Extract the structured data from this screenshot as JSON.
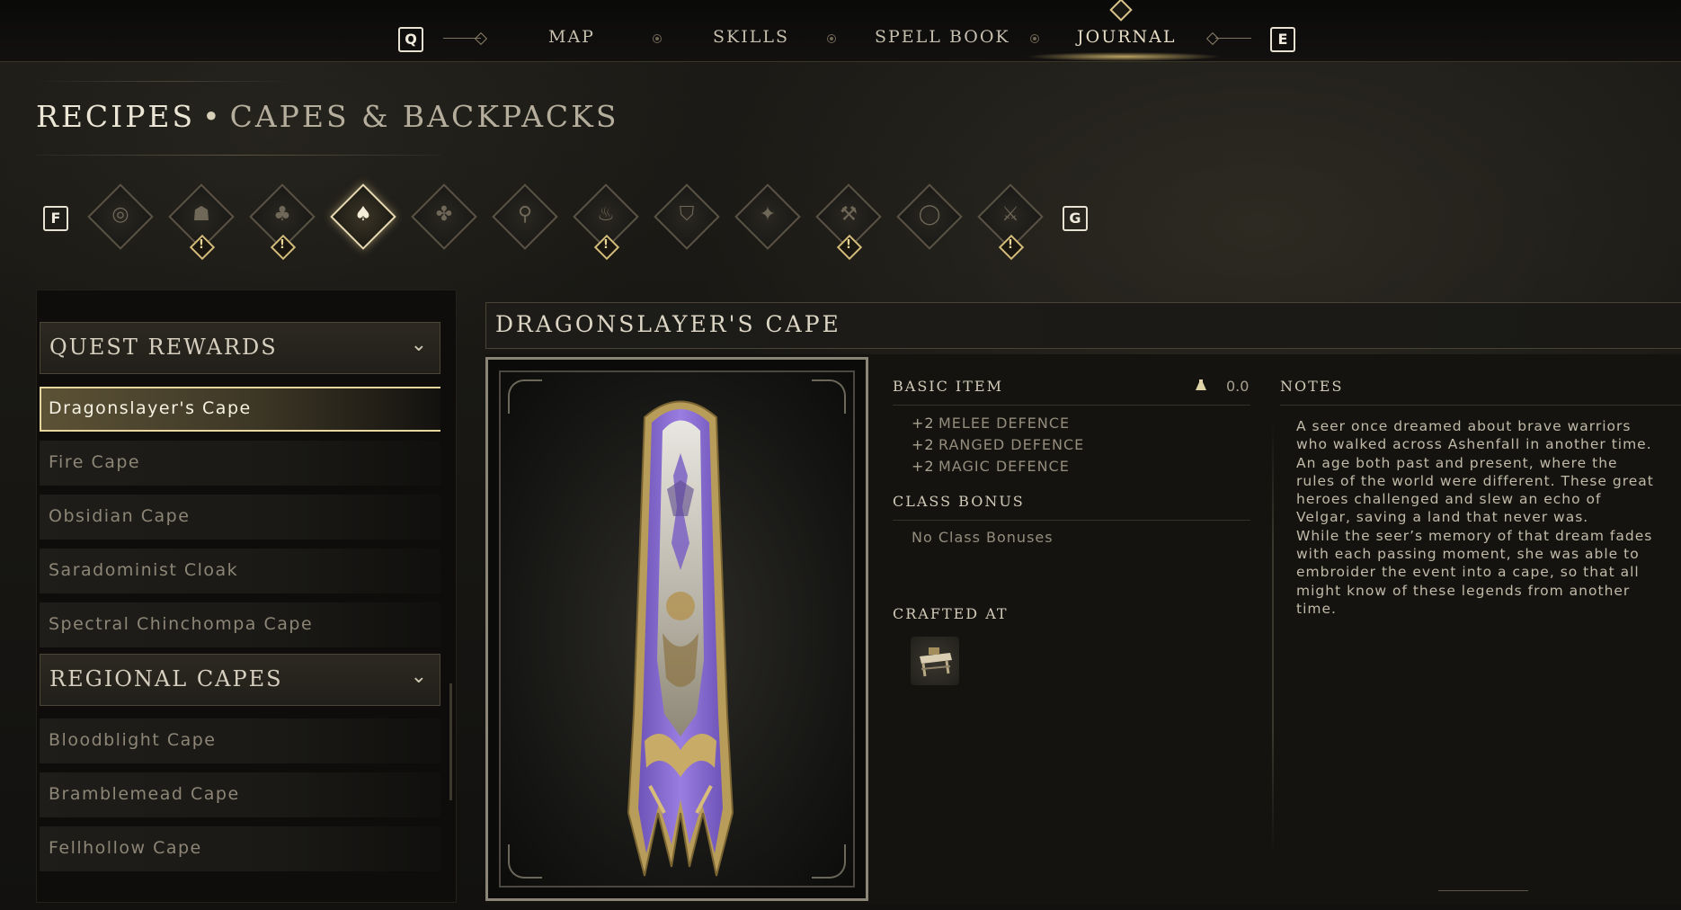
{
  "top_nav": {
    "prev_key": "Q",
    "next_key": "E",
    "items": [
      {
        "label": "MAP",
        "active": false
      },
      {
        "label": "SKILLS",
        "active": false
      },
      {
        "label": "SPELL BOOK",
        "active": false
      },
      {
        "label": "JOURNAL",
        "active": true
      }
    ]
  },
  "page_title": {
    "section": "RECIPES",
    "separator": "•",
    "category": "CAPES & BACKPACKS"
  },
  "category_bar": {
    "prev_key": "F",
    "next_key": "G",
    "categories": [
      {
        "icon": "helmet-ring-icon",
        "alert": false,
        "active": false
      },
      {
        "icon": "hood-icon",
        "alert": true,
        "active": false
      },
      {
        "icon": "herbs-icon",
        "alert": true,
        "active": false
      },
      {
        "icon": "cape-icon",
        "alert": false,
        "active": true
      },
      {
        "icon": "clover-icon",
        "alert": false,
        "active": false
      },
      {
        "icon": "feather-icon",
        "alert": false,
        "active": false
      },
      {
        "icon": "campfire-icon",
        "alert": true,
        "active": false
      },
      {
        "icon": "shield-icon",
        "alert": false,
        "active": false
      },
      {
        "icon": "sparkle-icon",
        "alert": false,
        "active": false
      },
      {
        "icon": "pickaxe-icon",
        "alert": true,
        "active": false
      },
      {
        "icon": "ring-icon",
        "alert": false,
        "active": false
      },
      {
        "icon": "axe-icon",
        "alert": true,
        "active": false
      }
    ],
    "alert_glyph": "!"
  },
  "recipe_list": {
    "groups": [
      {
        "label": "QUEST REWARDS",
        "items": [
          "Dragonslayer's Cape",
          "Fire Cape",
          "Obsidian Cape",
          "Saradominist Cloak",
          "Spectral Chinchompa Cape"
        ]
      },
      {
        "label": "REGIONAL CAPES",
        "items": [
          "Bloodblight Cape",
          "Bramblemead Cape",
          "Fellhollow Cape"
        ]
      }
    ],
    "selected": "Dragonslayer's Cape",
    "chevron": "⌄"
  },
  "detail": {
    "title": "DRAGONSLAYER'S CAPE",
    "basic_item_label": "BASIC ITEM",
    "weight": "0.0",
    "stats": [
      {
        "value": "+2",
        "label": "MELEE DEFENCE"
      },
      {
        "value": "+2",
        "label": "RANGED DEFENCE"
      },
      {
        "value": "+2",
        "label": "MAGIC DEFENCE"
      }
    ],
    "class_bonus_label": "CLASS BONUS",
    "class_bonus_value": "No Class Bonuses",
    "crafted_at_label": "CRAFTED AT",
    "crafted_at_icon": "crafting-table-icon",
    "notes_label": "NOTES",
    "notes_text": "A seer once dreamed about brave warriors\nwho walked across Ashenfall in another time.\nAn age both past and present, where the\nrules of the world were different. These great\nheroes challenged and slew an echo of\nVelgar, saving a land that never was.\nWhile the seer’s memory of that dream fades\nwith each passing moment, she was able to\nembroider the event into a cape, so that all\nmight know of these legends from another\ntime."
  },
  "colors": {
    "accent_gold": "#e6d59c",
    "cape_purple": "#8f6fd6",
    "background": "#151411"
  }
}
